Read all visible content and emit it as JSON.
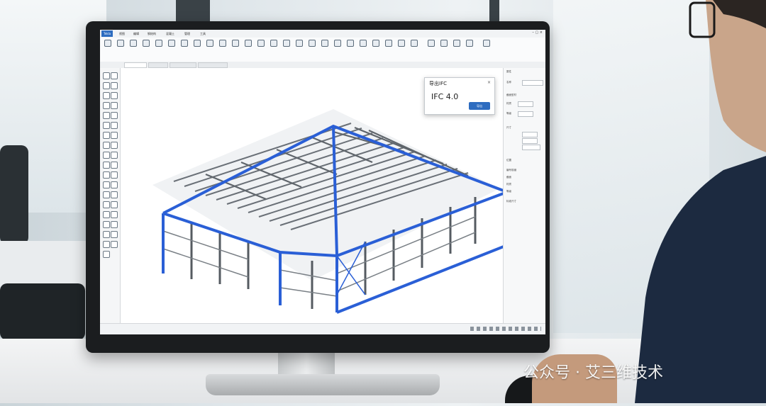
{
  "menus": [
    "Tekla",
    "视图",
    "编辑",
    "钢结构",
    "混凝土",
    "管理",
    "工具"
  ],
  "dialog": {
    "title": "导出IFC",
    "close": "×",
    "version_label": "IFC 4.0",
    "button_label": "导出"
  },
  "right_panel": {
    "header": "属性",
    "lines": [
      "名称",
      "截面型材",
      "材质",
      "等级",
      "尺寸",
      "位置",
      "编号前缀",
      "截面",
      "材质",
      "等级",
      "标准尺寸"
    ]
  },
  "watermark": "公众号 · 艾三维技术",
  "colors": {
    "accent_blue": "#2d6cc0",
    "frame_blue": "#2a5fd6",
    "steel_gray": "#6a7077"
  }
}
